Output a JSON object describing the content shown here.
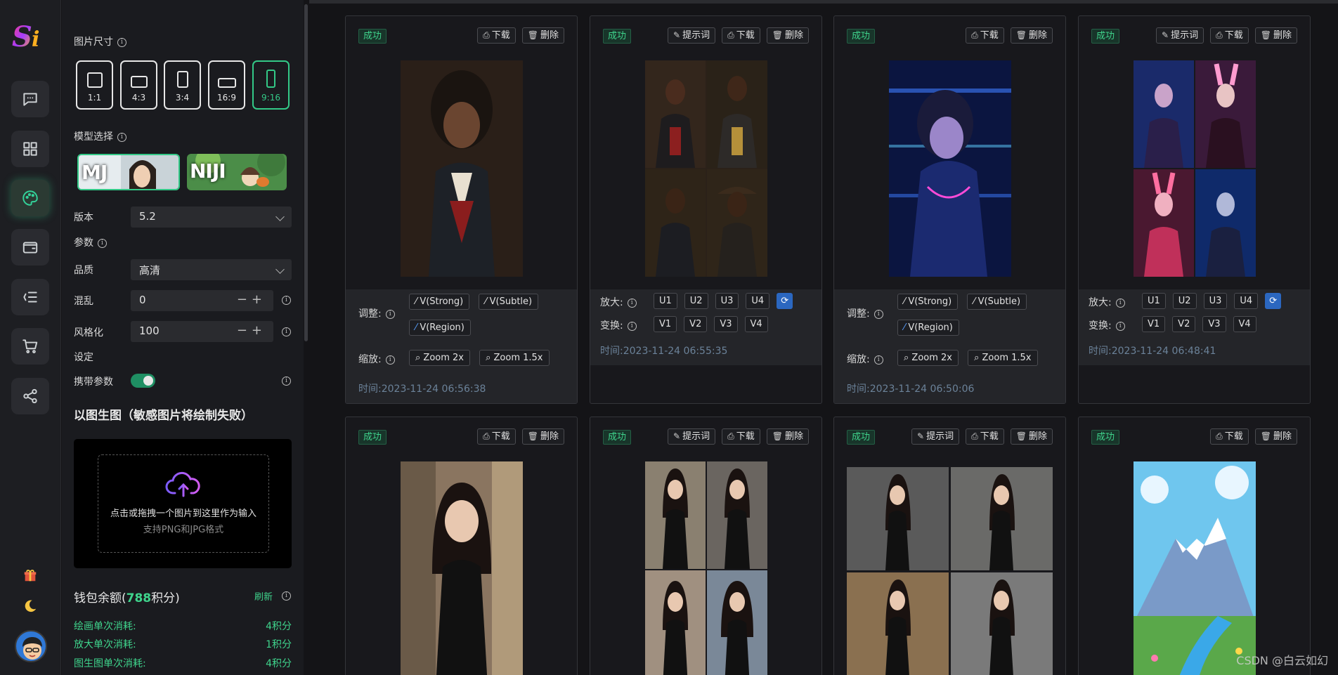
{
  "sidebar": {
    "logo": "Si",
    "nav": [
      {
        "name": "chat-icon"
      },
      {
        "name": "apps-icon"
      },
      {
        "name": "palette-icon",
        "active": true
      },
      {
        "name": "wallet-icon"
      },
      {
        "name": "list-indent-icon"
      },
      {
        "name": "cart-icon"
      },
      {
        "name": "share-icon"
      }
    ],
    "bottom": [
      "gift-icon",
      "moon-icon",
      "user-avatar"
    ]
  },
  "settings": {
    "size_label": "图片尺寸",
    "ratios": [
      {
        "label": "1:1",
        "active": false
      },
      {
        "label": "4:3",
        "active": false
      },
      {
        "label": "3:4",
        "active": false
      },
      {
        "label": "16:9",
        "active": false
      },
      {
        "label": "9:16",
        "active": true
      }
    ],
    "model_label": "模型选择",
    "models": [
      {
        "label": "MJ",
        "active": true
      },
      {
        "label": "NIJI",
        "active": false
      }
    ],
    "version_label": "版本",
    "version_value": "5.2",
    "params_label": "参数",
    "quality_label": "品质",
    "quality_value": "高清",
    "chaos_label": "混乱",
    "chaos_value": "0",
    "stylize_label": "风格化",
    "stylize_value": "100",
    "setting_label": "设定",
    "carry_label": "携带参数",
    "carry_on": true,
    "img2img_title": "以图生图（敏感图片将绘制失败）",
    "upload_main": "点击或拖拽一个图片到这里作为输入",
    "upload_sub": "支持PNG和JPG格式",
    "wallet_prefix": "钱包余额(",
    "wallet_points": "788",
    "wallet_suffix": "积分)",
    "refresh": "刷新",
    "costs": [
      {
        "label": "绘画单次消耗:",
        "value": "4积分"
      },
      {
        "label": "放大单次消耗:",
        "value": "1积分"
      },
      {
        "label": "图生图单次消耗:",
        "value": "4积分"
      }
    ]
  },
  "labels": {
    "success": "成功",
    "prompt": "提示词",
    "download": "下载",
    "delete": "删除",
    "adjust": "调整:",
    "zoom": "缩放:",
    "upscale": "放大:",
    "vary": "变换:",
    "time_prefix": "时间:",
    "v_strong": "V(Strong)",
    "v_subtle": "V(Subtle)",
    "v_region": "V(Region)",
    "zoom2x": "Zoom 2x",
    "zoom15x": "Zoom 1.5x",
    "u_buttons": [
      "U1",
      "U2",
      "U3",
      "U4"
    ],
    "v_buttons": [
      "V1",
      "V2",
      "V3",
      "V4"
    ]
  },
  "cards": [
    {
      "type": "single",
      "has_prompt": false,
      "time": "2023-11-24 06:56:38"
    },
    {
      "type": "grid",
      "has_prompt": true,
      "time": "2023-11-24 06:55:35"
    },
    {
      "type": "single",
      "has_prompt": false,
      "time": "2023-11-24 06:50:06"
    },
    {
      "type": "grid",
      "has_prompt": true,
      "time": "2023-11-24 06:48:41"
    },
    {
      "type": "single",
      "has_prompt": false
    },
    {
      "type": "grid",
      "has_prompt": true
    },
    {
      "type": "grid",
      "has_prompt": true
    },
    {
      "type": "single",
      "has_prompt": false
    }
  ],
  "watermark": "CSDN @白云如幻",
  "colors": {
    "accent": "#33c987",
    "link": "#6b8299",
    "panel": "#1a1b1f"
  }
}
